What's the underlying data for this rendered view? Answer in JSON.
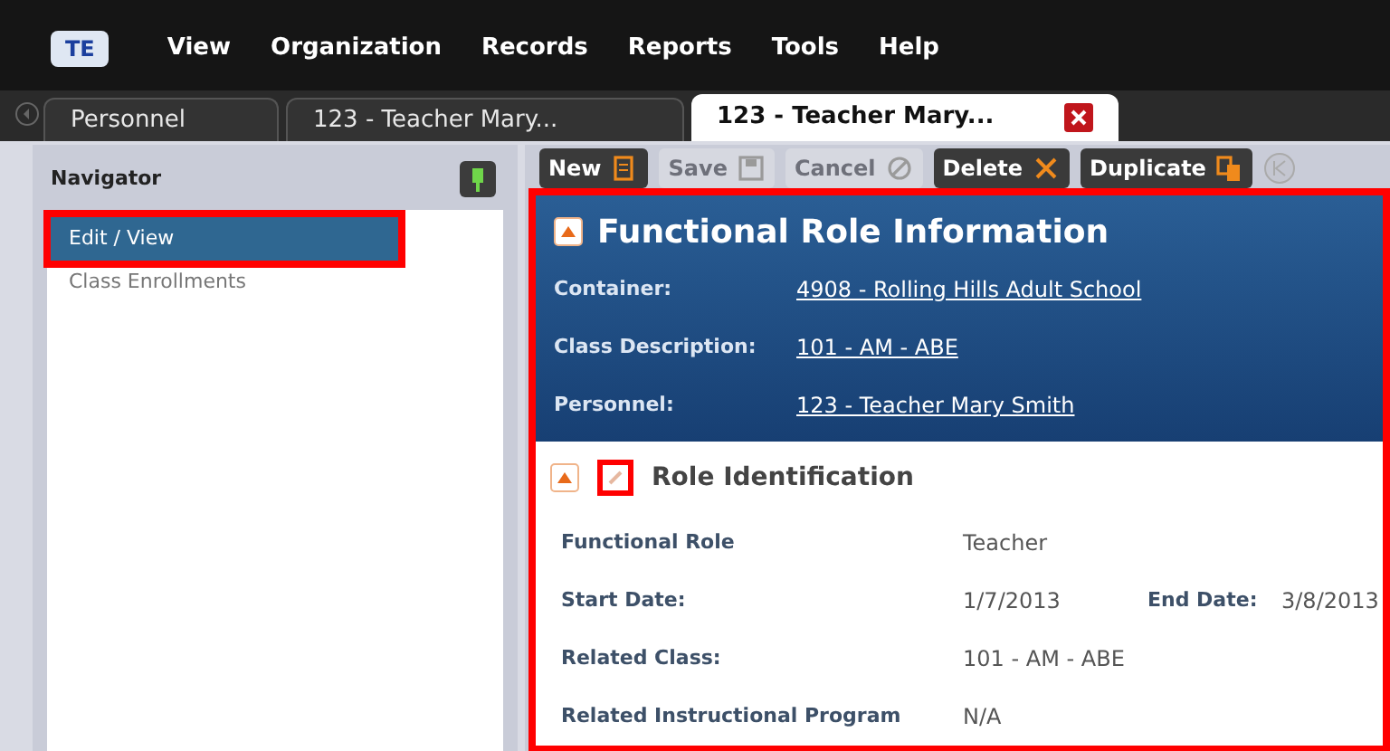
{
  "menu": {
    "logo": "TE",
    "items": [
      "View",
      "Organization",
      "Records",
      "Reports",
      "Tools",
      "Help"
    ]
  },
  "tabs": [
    {
      "label": "Personnel",
      "selected": false,
      "closable": false
    },
    {
      "label": "123 - Teacher Mary...",
      "selected": false,
      "closable": false
    },
    {
      "label": "123 - Teacher Mary...",
      "selected": true,
      "closable": true
    }
  ],
  "navigator": {
    "title": "Navigator",
    "items": [
      {
        "label": "Edit / View",
        "selected": true,
        "highlighted": true
      },
      {
        "label": "Class Enrollments",
        "selected": false,
        "highlighted": false
      }
    ]
  },
  "toolbar": [
    {
      "label": "New",
      "kind": "new",
      "disabled": false
    },
    {
      "label": "Save",
      "kind": "save",
      "disabled": true
    },
    {
      "label": "Cancel",
      "kind": "cancel",
      "disabled": true
    },
    {
      "label": "Delete",
      "kind": "delete",
      "disabled": false
    },
    {
      "label": "Duplicate",
      "kind": "duplicate",
      "disabled": false
    }
  ],
  "content": {
    "highlighted": true,
    "header": {
      "title": "Functional Role Information",
      "fields": [
        {
          "label": "Container:",
          "value": "4908 - Rolling Hills Adult School"
        },
        {
          "label": "Class Description:",
          "value": "101 - AM - ABE"
        },
        {
          "label": "Personnel:",
          "value": "123 - Teacher Mary Smith"
        }
      ]
    },
    "section": {
      "title": "Role Identification",
      "edit_highlighted": true,
      "rows": [
        [
          {
            "label": "Functional Role",
            "value": "Teacher"
          }
        ],
        [
          {
            "label": "Start Date:",
            "value": "1/7/2013"
          },
          {
            "label": "End Date:",
            "value": "3/8/2013"
          }
        ],
        [
          {
            "label": "Related Class:",
            "value": "101 - AM - ABE"
          }
        ],
        [
          {
            "label": "Related Instructional Program",
            "value": "N/A"
          }
        ]
      ]
    }
  }
}
